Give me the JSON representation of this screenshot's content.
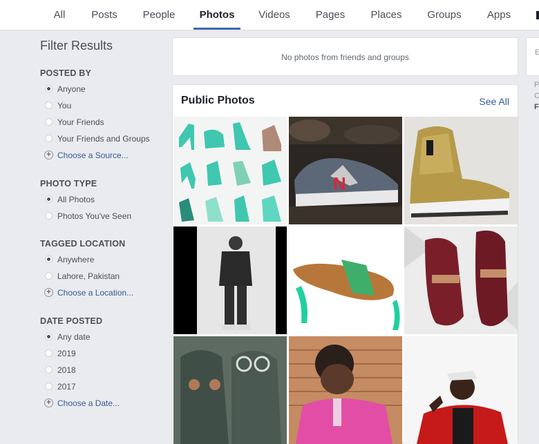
{
  "tabs": [
    "All",
    "Posts",
    "People",
    "Photos",
    "Videos",
    "Pages",
    "Places",
    "Groups",
    "Apps"
  ],
  "active_tab": "Photos",
  "filters": {
    "title": "Filter Results",
    "posted_by": {
      "title": "POSTED BY",
      "options": [
        "Anyone",
        "You",
        "Your Friends",
        "Your Friends and Groups"
      ],
      "selected": "Anyone",
      "choose": "Choose a Source..."
    },
    "photo_type": {
      "title": "PHOTO TYPE",
      "options": [
        "All Photos",
        "Photos You've Seen"
      ],
      "selected": "All Photos"
    },
    "tagged_location": {
      "title": "TAGGED LOCATION",
      "options": [
        "Anywhere",
        "Lahore, Pakistan"
      ],
      "selected": "Anywhere",
      "choose": "Choose a Location..."
    },
    "date_posted": {
      "title": "DATE POSTED",
      "options": [
        "Any date",
        "2019",
        "2018",
        "2017"
      ],
      "selected": "Any date",
      "choose": "Choose a Date..."
    }
  },
  "no_photos_message": "No photos from friends and groups",
  "public_photos": {
    "title": "Public Photos",
    "see_all": "See All",
    "photos": [
      "teal-high-heels-collage",
      "grey-new-balance-sneaker",
      "gold-high-top-sneaker",
      "man-standing-black-white",
      "green-sandal-on-white",
      "burgundy-loafers",
      "old-shoes-with-face",
      "woman-pink-top-with-drink",
      "man-red-jacket"
    ]
  },
  "right_stub": {
    "top": "E",
    "mid1": "P",
    "mid2": "C",
    "mid3": "F"
  },
  "colors": {
    "accent": "#4267b2",
    "link": "#385898",
    "background": "#e9ebee"
  }
}
